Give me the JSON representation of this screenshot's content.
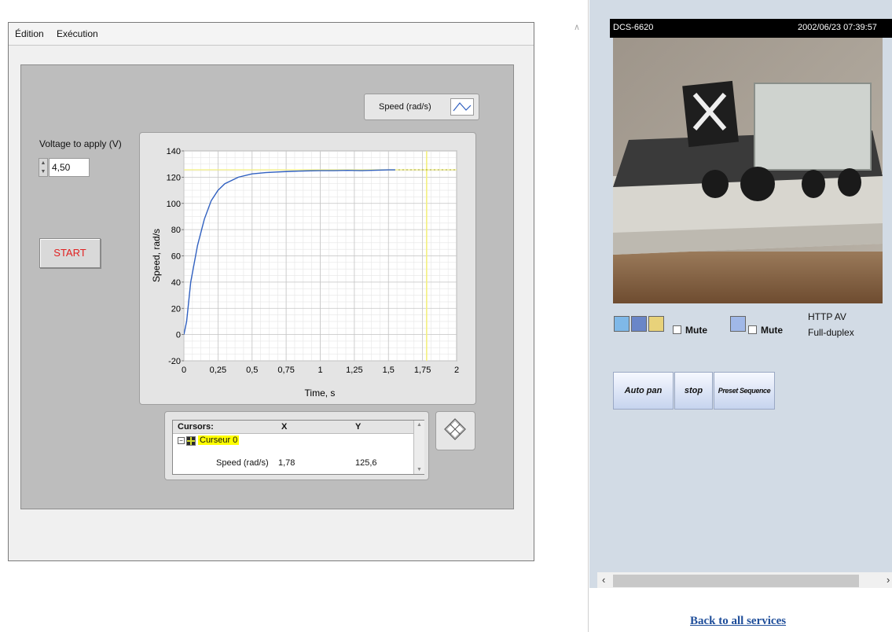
{
  "menu": {
    "edit": "Édition",
    "run": "Exécution"
  },
  "voltage": {
    "label": "Voltage to apply (V)",
    "value": "4,50"
  },
  "start_label": "START",
  "legend": {
    "label": "Speed (rad/s)"
  },
  "chart_data": {
    "type": "line",
    "xlabel": "Time, s",
    "ylabel": "Speed, rad/s",
    "xlim": [
      0,
      2
    ],
    "ylim": [
      -20,
      140
    ],
    "x_ticks": [
      "0",
      "0,25",
      "0,5",
      "0,75",
      "1",
      "1,25",
      "1,5",
      "1,75",
      "2"
    ],
    "y_ticks": [
      "-20",
      "0",
      "20",
      "40",
      "60",
      "80",
      "100",
      "120",
      "140"
    ],
    "grid": true,
    "series": [
      {
        "name": "Speed (rad/s)",
        "color": "#3060c0",
        "x": [
          0,
          0.02,
          0.05,
          0.1,
          0.15,
          0.2,
          0.25,
          0.3,
          0.4,
          0.5,
          0.6,
          0.7,
          0.8,
          0.9,
          1.0,
          1.1,
          1.2,
          1.3,
          1.4,
          1.5,
          1.55
        ],
        "y": [
          0,
          10,
          40,
          68,
          88,
          102,
          110,
          115,
          120,
          122.5,
          123.5,
          124,
          124.5,
          124.8,
          125,
          125,
          125.2,
          125,
          125.3,
          125.6,
          125.6
        ]
      }
    ],
    "reference_line": {
      "y": 125.6,
      "color": "#f4f080"
    },
    "cursor": {
      "x": 1.78,
      "color": "#f4f080"
    }
  },
  "cursors": {
    "headers": {
      "name": "Cursors:",
      "x": "X",
      "y": "Y"
    },
    "cursor_name": "Curseur 0",
    "row": {
      "name": "Speed (rad/s)",
      "x": "1,78",
      "y": "125,6"
    },
    "highlight_color": "#ffff00"
  },
  "camera": {
    "title": "DCS-6620",
    "timestamp": "2002/06/23 07:39:57",
    "mute_label_1": "Mute",
    "mute_label_2": "Mute",
    "mode_line1": "HTTP  AV",
    "mode_line2": "Full-duplex"
  },
  "ptz": {
    "auto_pan": "Auto pan",
    "stop": "stop",
    "preset": "Preset Sequence"
  },
  "back_link": "Back to all services"
}
